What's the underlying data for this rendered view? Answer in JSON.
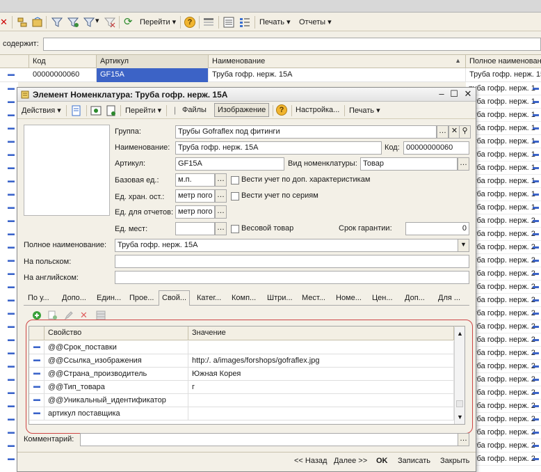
{
  "background": {
    "toolbar": {
      "go_label": "Перейти",
      "print_label": "Печать",
      "reports_label": "Отчеты"
    },
    "filter_label": "содержит:",
    "table": {
      "columns": [
        "Код",
        "Артикул",
        "Наименование",
        "Полное наименование"
      ],
      "first_row": [
        "00000000060",
        "GF15A",
        "Труба гофр. нерж. 15A",
        "Труба гофр. нерж. 15A"
      ],
      "right_rows": [
        "руба гофр. нерж. 1",
        "руба гофр. нерж. 1",
        "руба гофр. нерж. 1",
        "руба гофр. нерж. 1",
        "руба гофр. нерж. 1",
        "руба гофр. нерж. 1",
        "руба гофр. нерж. 1",
        "руба гофр. нерж. 1",
        "руба гофр. нерж. 1",
        "руба гофр. нерж. 1",
        "руба гофр. нерж. 2",
        "руба гофр. нерж. 2",
        "руба гофр. нерж. 2",
        "руба гофр. нерж. 2",
        "руба гофр. нерж. 2",
        "руба гофр. нерж. 2",
        "руба гофр. нерж. 2",
        "руба гофр. нерж. 2",
        "руба гофр. нерж. 2",
        "руба гофр. нерж. 2",
        "руба гофр. нерж. 2",
        "руба гофр. нерж. 2",
        "руба гофр. нерж. 2",
        "руба гофр. нерж. 2",
        "руба гофр. нерж. 2",
        "руба гофр. нерж. 2",
        "руба гофр. нерж. 2",
        "руба гофр. нерж. 2",
        "руба гофр. нерж. 2"
      ]
    }
  },
  "dialog": {
    "title": "Элемент Номенклатура: Труба гофр. нерж. 15A",
    "toolbar": {
      "actions": "Действия",
      "go": "Перейти",
      "files": "Файлы",
      "image": "Изображение",
      "settings": "Настройка...",
      "print": "Печать"
    },
    "form": {
      "group_label": "Группа:",
      "group_value": "Трубы Gofraflex под фитинги",
      "name_label": "Наименование:",
      "name_value": "Труба гофр. нерж. 15A",
      "code_label": "Код:",
      "code_value": "00000000060",
      "article_label": "Артикул:",
      "article_value": "GF15A",
      "kind_label": "Вид номенклатуры:",
      "kind_value": "Товар",
      "base_unit_label": "Базовая ед.:",
      "base_unit_value": "м.п.",
      "extra_chars_label": "Вести учет по доп. характеристикам",
      "storage_unit_label": "Ед. хран. ост.:",
      "storage_unit_value": "метр пого",
      "series_label": "Вести учет по сериям",
      "report_unit_label": "Ед. для отчетов:",
      "report_unit_value": "метр пого",
      "place_unit_label": "Ед. мест:",
      "place_unit_value": "",
      "weight_label": "Весовой товар",
      "warranty_label": "Срок гарантии:",
      "warranty_value": "0",
      "full_name_label": "Полное наименование:",
      "full_name_value": "Труба гофр. нерж. 15A",
      "polish_label": "На польском:",
      "english_label": "На английском:"
    },
    "tabs": [
      "По у...",
      "Допо...",
      "Един...",
      "Прое...",
      "Свой...",
      "Катег...",
      "Комп...",
      "Штри...",
      "Мест...",
      "Номе...",
      "Цен...",
      "Доп...",
      "Для ..."
    ],
    "properties": {
      "columns": [
        "Свойство",
        "Значение"
      ],
      "rows": [
        {
          "name": "@@Срок_поставки",
          "value": ""
        },
        {
          "name": "@@Ссылка_изображения",
          "value": "http:/.                a/images/forshops/gofraflex.jpg"
        },
        {
          "name": "@@Страна_производитель",
          "value": "Южная Корея"
        },
        {
          "name": "@@Тип_товара",
          "value": "г"
        },
        {
          "name": "@@Уникальный_идентификатор",
          "value": ""
        },
        {
          "name": "артикул поставщика",
          "value": ""
        }
      ]
    },
    "comment_label": "Комментарий:",
    "bottom": {
      "back": "<< Назад",
      "next": "Далее >>",
      "ok": "OK",
      "save": "Записать",
      "close": "Закрыть"
    }
  }
}
